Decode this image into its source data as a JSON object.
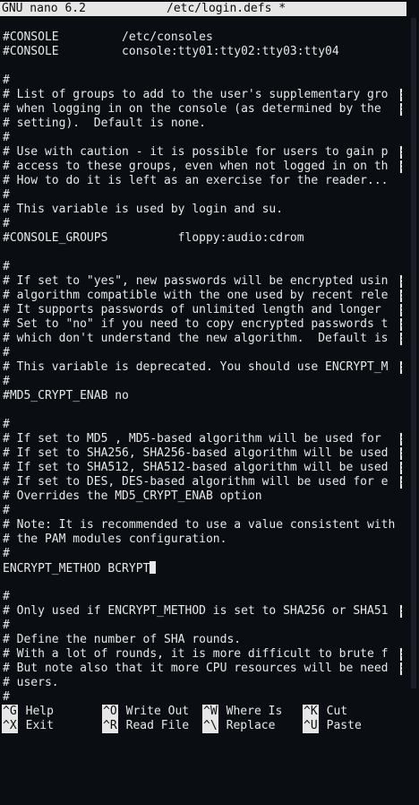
{
  "titlebar": {
    "app": "GNU nano 6.2",
    "file": "/etc/login.defs *"
  },
  "editor": {
    "lines": [
      "#CONSOLE         /etc/consoles",
      "#CONSOLE         console:tty01:tty02:tty03:tty04",
      "",
      "#",
      "# List of groups to add to the user's supplementary gro",
      "# when logging in on the console (as determined by the ",
      "# setting).  Default is none.",
      "#",
      "# Use with caution - it is possible for users to gain p",
      "# access to these groups, even when not logged in on th",
      "# How to do it is left as an exercise for the reader...",
      "#",
      "# This variable is used by login and su.",
      "#",
      "#CONSOLE_GROUPS          floppy:audio:cdrom",
      "",
      "#",
      "# If set to \"yes\", new passwords will be encrypted usin",
      "# algorithm compatible with the one used by recent rele",
      "# It supports passwords of unlimited length and longer ",
      "# Set to \"no\" if you need to copy encrypted passwords t",
      "# which don't understand the new algorithm.  Default is",
      "#",
      "# This variable is deprecated. You should use ENCRYPT_M",
      "#",
      "#MD5_CRYPT_ENAB no",
      "",
      "#",
      "# If set to MD5 , MD5-based algorithm will be used for ",
      "# If set to SHA256, SHA256-based algorithm will be used",
      "# If set to SHA512, SHA512-based algorithm will be used",
      "# If set to DES, DES-based algorithm will be used for e",
      "# Overrides the MD5_CRYPT_ENAB option",
      "#",
      "# Note: It is recommended to use a value consistent with",
      "# the PAM modules configuration.",
      "#",
      "ENCRYPT_METHOD BCRYPT",
      "",
      "#",
      "# Only used if ENCRYPT_METHOD is set to SHA256 or SHA51",
      "#",
      "# Define the number of SHA rounds.",
      "# With a lot of rounds, it is more difficult to brute f",
      "# But note also that it more CPU resources will be need",
      "# users.",
      "#"
    ],
    "overflow_marker": ">"
  },
  "shortcuts": {
    "row1": [
      {
        "key": "^G",
        "label": "Help"
      },
      {
        "key": "^O",
        "label": "Write Out"
      },
      {
        "key": "^W",
        "label": "Where Is"
      },
      {
        "key": "^K",
        "label": "Cut"
      }
    ],
    "row2": [
      {
        "key": "^X",
        "label": "Exit"
      },
      {
        "key": "^R",
        "label": "Read File"
      },
      {
        "key": "^\\",
        "label": "Replace"
      },
      {
        "key": "^U",
        "label": "Paste"
      }
    ]
  }
}
